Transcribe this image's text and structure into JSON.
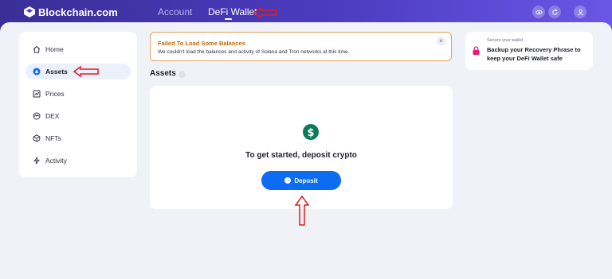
{
  "header": {
    "logo_text": "Blockchain.com",
    "tabs": [
      {
        "label": "Account",
        "active": false
      },
      {
        "label": "DeFi Wallet",
        "active": true
      }
    ],
    "icons": [
      "eye-icon",
      "refresh-icon",
      "user-icon"
    ]
  },
  "sidebar": {
    "items": [
      {
        "label": "Home",
        "icon": "home-icon",
        "active": false
      },
      {
        "label": "Assets",
        "icon": "assets-icon",
        "active": true
      },
      {
        "label": "Prices",
        "icon": "prices-icon",
        "active": false
      },
      {
        "label": "DEX",
        "icon": "dex-icon",
        "active": false
      },
      {
        "label": "NFTs",
        "icon": "nfts-icon",
        "active": false
      },
      {
        "label": "Activity",
        "icon": "activity-icon",
        "active": false
      }
    ]
  },
  "alert": {
    "title": "Failed To Load Some Balances",
    "body": "We couldn't load the balances and activity of Solana and Tron networks at this time.",
    "close_symbol": "×"
  },
  "assets": {
    "title": "Assets",
    "empty_message": "To get started, deposit crypto",
    "deposit_label": "Deposit",
    "deposit_icon_symbol": "↓"
  },
  "backup": {
    "subtitle": "Secure your wallet",
    "title": "Backup your Recovery Phrase to keep your DeFi Wallet safe"
  },
  "colors": {
    "brand_gradient_start": "#3a2e96",
    "brand_gradient_end": "#6b56e6",
    "primary_button": "#0c6cf2",
    "alert_border": "#e0a35f",
    "alert_title": "#c46a06",
    "annotation": "#e11d1d",
    "dollar_coin": "#0f7a5a",
    "lock": "#e6197a"
  }
}
